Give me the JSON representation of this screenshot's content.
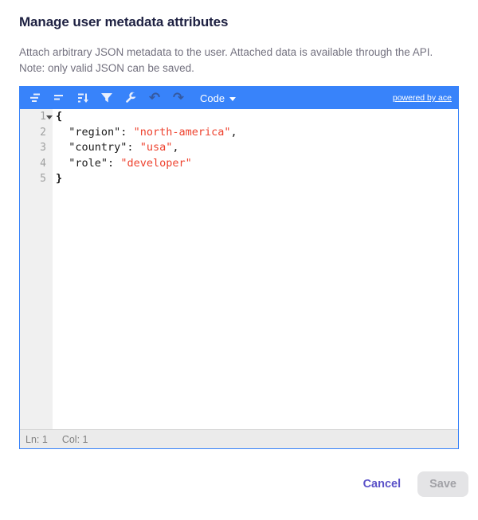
{
  "modal": {
    "title": "Manage user metadata attributes",
    "description": "Attach arbitrary JSON metadata to the user. Attached data is available through the API.",
    "note": "Note: only valid JSON can be saved."
  },
  "editor": {
    "toolbar": {
      "icons": [
        {
          "name": "format",
          "disabled": false
        },
        {
          "name": "compact",
          "disabled": false
        },
        {
          "name": "sort",
          "disabled": false
        },
        {
          "name": "filter",
          "disabled": false
        },
        {
          "name": "repair",
          "disabled": false
        },
        {
          "name": "undo",
          "disabled": true
        },
        {
          "name": "redo",
          "disabled": true
        }
      ],
      "mode_label": "Code",
      "powered_by": "powered by ace"
    },
    "code": {
      "lines": [
        {
          "number": "1",
          "fold": true,
          "tokens": [
            {
              "t": "brace",
              "v": "{"
            }
          ]
        },
        {
          "number": "2",
          "fold": false,
          "tokens": [
            {
              "t": "plain",
              "v": "  "
            },
            {
              "t": "key",
              "v": "\"region\""
            },
            {
              "t": "punct",
              "v": ": "
            },
            {
              "t": "str",
              "v": "\"north-america\""
            },
            {
              "t": "punct",
              "v": ","
            }
          ]
        },
        {
          "number": "3",
          "fold": false,
          "tokens": [
            {
              "t": "plain",
              "v": "  "
            },
            {
              "t": "key",
              "v": "\"country\""
            },
            {
              "t": "punct",
              "v": ": "
            },
            {
              "t": "str",
              "v": "\"usa\""
            },
            {
              "t": "punct",
              "v": ","
            }
          ]
        },
        {
          "number": "4",
          "fold": false,
          "tokens": [
            {
              "t": "plain",
              "v": "  "
            },
            {
              "t": "key",
              "v": "\"role\""
            },
            {
              "t": "punct",
              "v": ": "
            },
            {
              "t": "str",
              "v": "\"developer\""
            }
          ]
        },
        {
          "number": "5",
          "fold": false,
          "tokens": [
            {
              "t": "brace",
              "v": "}"
            }
          ]
        }
      ]
    },
    "statusbar": {
      "ln_label": "Ln: 1",
      "col_label": "Col: 1"
    }
  },
  "footer": {
    "cancel_label": "Cancel",
    "save_label": "Save"
  },
  "colors": {
    "toolbar_blue": "#3883fa",
    "string_red": "#ee422e",
    "key_black": "#1a1a1a",
    "gutter_gray": "#f0f0f0",
    "statusbar_gray": "#ebebeb",
    "accent_purple": "#5a51c8",
    "title_navy": "#1e2142",
    "description_gray": "#73717f"
  }
}
